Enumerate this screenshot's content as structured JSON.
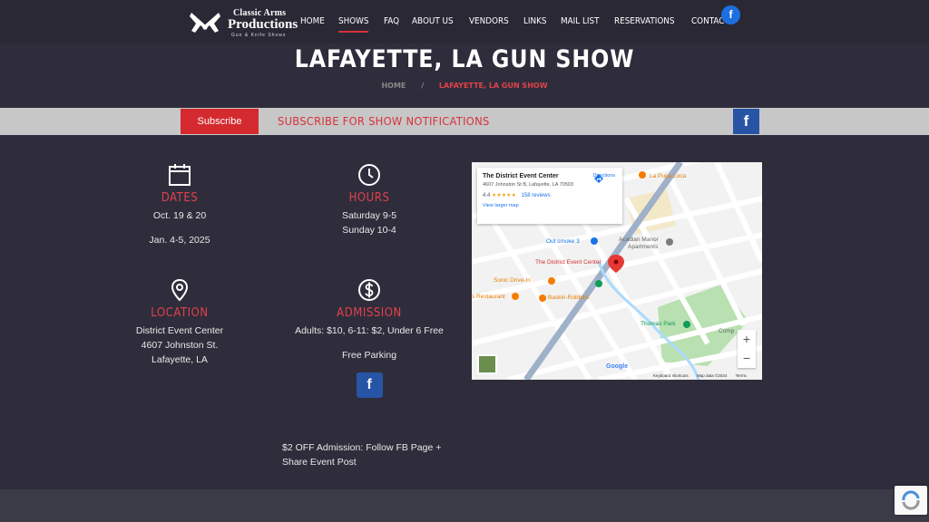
{
  "header": {
    "logo": {
      "line1": "Classic Arms",
      "line2": "Productions",
      "line3": "Gun & Knife Shows"
    },
    "nav": [
      "HOME",
      "SHOWS",
      "FAQ",
      "ABOUT US",
      "VENDORS",
      "LINKS",
      "MAIL LIST",
      "RESERVATIONS",
      "CONTACT"
    ],
    "active_nav": "SHOWS",
    "facebook_glyph": "f"
  },
  "page": {
    "title": "LAFAYETTE, LA GUN SHOW",
    "breadcrumb": {
      "home": "HOME",
      "separator": "/",
      "current": "LAFAYETTE, LA GUN SHOW"
    }
  },
  "subscribe_bar": {
    "button": "Subscribe",
    "text": "SUBSCRIBE FOR SHOW NOTIFICATIONS",
    "facebook_glyph": "f"
  },
  "info": {
    "dates": {
      "icon": "calendar-icon",
      "heading": "DATES",
      "lines": [
        "Oct. 19 & 20",
        "Jan. 4-5, 2025"
      ]
    },
    "hours": {
      "icon": "clock-icon",
      "heading": "HOURS",
      "lines": [
        "Saturday 9-5",
        "Sunday 10-4"
      ]
    },
    "location": {
      "icon": "location-pin-icon",
      "heading": "LOCATION",
      "lines": [
        "District Event Center",
        "4607 Johnston St.",
        "Lafayette, LA"
      ]
    },
    "admission": {
      "icon": "dollar-icon",
      "heading": "ADMISSION",
      "lines": [
        "Adults: $10, 6-11: $2, Under 6 Free",
        "Free Parking"
      ],
      "facebook_glyph": "f"
    }
  },
  "promo": "$2 OFF Admission: Follow FB Page + Share Event Post",
  "map": {
    "place_name": "The District Event Center",
    "address": "4607 Johnston St B, Lafayette, LA 70503",
    "rating": "4.4",
    "stars": "★★★★★",
    "reviews": "158 reviews",
    "directions": "Directions",
    "larger_map": "View larger map",
    "zoom_in": "+",
    "zoom_out": "−",
    "google": "Google",
    "footer": [
      "Keyboard shortcuts",
      "Map data ©2024",
      "Terms"
    ],
    "labels": {
      "la_pupa": "La Pupa Loca",
      "out_smoke": "Out smoke 3",
      "acadian_1": "Acadian Manor",
      "acadian_2": "Apartments",
      "district": "The District Event Center",
      "sonic": "Sonic Drive-In",
      "restaurant": "s Restaurant",
      "baskin": "Baskin-Robbins",
      "thomas_park": "Thomas Park",
      "compt": "Comp"
    },
    "colors": {
      "park": "#b8e0b0",
      "water": "#aadaff",
      "highway": "#9fb1c9",
      "pin": "#e53935"
    }
  },
  "colors": {
    "accent": "#d9303a",
    "background": "#2f2d3b",
    "facebook": "#2854a6"
  }
}
